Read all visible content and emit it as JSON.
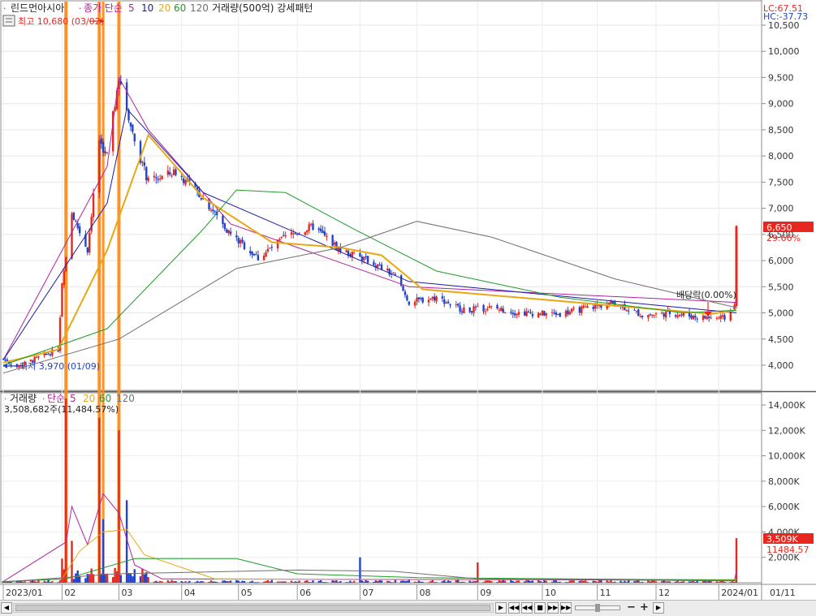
{
  "stock": {
    "name": "린드먼아시아",
    "price_legend": "종가 단순",
    "ma_periods": [
      "5",
      "10",
      "20",
      "60",
      "120"
    ],
    "volume_indicator": "거래량(500억) 강세패턴",
    "high_marker": "최고 10,680 (03/02)",
    "low_marker": "최저 3,970 (01/09)",
    "current_price": "6,650",
    "change_pct": "29.66%",
    "dividend_label": "배당락(0.00%)",
    "lc": "LC:67.51",
    "hc": "HC:-37.73"
  },
  "volume": {
    "legend_title": "거래량",
    "legend_ma": "단순",
    "ma_periods": [
      "5",
      "20",
      "60",
      "120"
    ],
    "last_volume": "3,508,682주(11,484.57%)",
    "current_badge": "3,509K",
    "pct_badge": "11484.57"
  },
  "axes": {
    "price_ticks": [
      "10,500",
      "10,000",
      "9,500",
      "9,000",
      "8,500",
      "8,000",
      "7,500",
      "7,000",
      "6,500",
      "6,000",
      "5,500",
      "5,000",
      "4,500",
      "4,000"
    ],
    "volume_ticks": [
      "14,000K",
      "12,000K",
      "10,000K",
      "8,000K",
      "6,000K",
      "4,000K",
      "2,000K"
    ],
    "months": [
      "2023/01",
      "02",
      "03",
      "04",
      "05",
      "06",
      "07",
      "08",
      "09",
      "10",
      "11",
      "12",
      "2024/01",
      "01/11"
    ]
  },
  "colors": {
    "up": "#e8281f",
    "down": "#2244cc",
    "ma5": "#b0219e",
    "ma10": "#1a1aa8",
    "ma20": "#e8a814",
    "ma60": "#1f9b2a",
    "ma120": "#707070",
    "highlight": "#ff8c1a",
    "badge": "#e8281f"
  },
  "scrollbar": {
    "zoom_minus": "−",
    "zoom_plus": "+"
  },
  "chart_data": {
    "type": "candlestick",
    "title": "린드먼아시아",
    "price_range": [
      3700,
      10800
    ],
    "volume_range": [
      0,
      15000
    ],
    "volume_unit": "K",
    "anchors": [
      {
        "date": "2023/01/02",
        "close": 4120
      },
      {
        "date": "2023/01/09",
        "close": 3970
      },
      {
        "date": "2023/01/30",
        "close": 4300
      },
      {
        "date": "2023/02/01",
        "close": 5600
      },
      {
        "date": "2023/02/06",
        "close": 6900
      },
      {
        "date": "2023/02/14",
        "close": 6200
      },
      {
        "date": "2023/02/20",
        "close": 8300
      },
      {
        "date": "2023/02/24",
        "close": 8000
      },
      {
        "date": "2023/03/02",
        "close": 9500
      },
      {
        "date": "2023/03/10",
        "close": 8300
      },
      {
        "date": "2023/03/17",
        "close": 7500
      },
      {
        "date": "2023/03/31",
        "close": 7700
      },
      {
        "date": "2023/04/14",
        "close": 7200
      },
      {
        "date": "2023/04/28",
        "close": 6500
      },
      {
        "date": "2023/05/12",
        "close": 6050
      },
      {
        "date": "2023/05/26",
        "close": 6450
      },
      {
        "date": "2023/06/09",
        "close": 6650
      },
      {
        "date": "2023/06/23",
        "close": 6200
      },
      {
        "date": "2023/07/07",
        "close": 6000
      },
      {
        "date": "2023/07/21",
        "close": 5700
      },
      {
        "date": "2023/07/28",
        "close": 5200
      },
      {
        "date": "2023/08/11",
        "close": 5300
      },
      {
        "date": "2023/08/25",
        "close": 5050
      },
      {
        "date": "2023/09/08",
        "close": 5100
      },
      {
        "date": "2023/09/22",
        "close": 5000
      },
      {
        "date": "2023/10/13",
        "close": 4980
      },
      {
        "date": "2023/10/27",
        "close": 5100
      },
      {
        "date": "2023/11/10",
        "close": 5200
      },
      {
        "date": "2023/11/24",
        "close": 4950
      },
      {
        "date": "2023/12/08",
        "close": 5000
      },
      {
        "date": "2023/12/22",
        "close": 4920
      },
      {
        "date": "2024/01/05",
        "close": 4900
      },
      {
        "date": "2024/01/10",
        "close": 5130
      },
      {
        "date": "2024/01/11",
        "close": 6650
      }
    ],
    "ma_series": [
      {
        "name": "5",
        "points": [
          [
            "2023/01/02",
            4100
          ],
          [
            "2023/02/24",
            7800
          ],
          [
            "2023/03/02",
            9500
          ],
          [
            "2023/03/17",
            8500
          ],
          [
            "2023/04/28",
            6700
          ],
          [
            "2023/07/28",
            5500
          ],
          [
            "2024/01/11",
            5200
          ]
        ]
      },
      {
        "name": "10",
        "points": [
          [
            "2023/01/02",
            4100
          ],
          [
            "2023/02/24",
            7100
          ],
          [
            "2023/03/06",
            8900
          ],
          [
            "2023/04/14",
            7300
          ],
          [
            "2023/07/28",
            5600
          ],
          [
            "2024/01/11",
            5000
          ]
        ]
      },
      {
        "name": "20",
        "points": [
          [
            "2023/01/02",
            4050
          ],
          [
            "2023/01/30",
            4300
          ],
          [
            "2023/02/24",
            6200
          ],
          [
            "2023/03/17",
            8400
          ],
          [
            "2023/04/14",
            7200
          ],
          [
            "2023/05/19",
            6350
          ],
          [
            "2023/06/23",
            6250
          ],
          [
            "2023/07/14",
            6100
          ],
          [
            "2023/08/04",
            5450
          ],
          [
            "2023/12/29",
            4980
          ],
          [
            "2024/01/11",
            5050
          ]
        ]
      },
      {
        "name": "60",
        "points": [
          [
            "2023/01/02",
            4000
          ],
          [
            "2023/02/24",
            4700
          ],
          [
            "2023/04/14",
            6600
          ],
          [
            "2023/05/01",
            7350
          ],
          [
            "2023/05/26",
            7300
          ],
          [
            "2023/06/30",
            6600
          ],
          [
            "2023/08/11",
            5800
          ],
          [
            "2023/10/13",
            5300
          ],
          [
            "2023/12/15",
            5000
          ],
          [
            "2024/01/11",
            5050
          ]
        ]
      },
      {
        "name": "120",
        "points": [
          [
            "2023/01/02",
            3850
          ],
          [
            "2023/03/02",
            4500
          ],
          [
            "2023/05/01",
            5850
          ],
          [
            "2023/06/23",
            6250
          ],
          [
            "2023/08/01",
            6750
          ],
          [
            "2023/09/08",
            6450
          ],
          [
            "2023/11/10",
            5650
          ],
          [
            "2024/01/11",
            5100
          ]
        ]
      }
    ],
    "volume_spikes": [
      {
        "date": "2023/02/01",
        "value": 1900
      },
      {
        "date": "2023/02/03",
        "value": 14500
      },
      {
        "date": "2023/02/06",
        "value": 3300
      },
      {
        "date": "2023/02/20",
        "value": 13000
      },
      {
        "date": "2023/02/22",
        "value": 5000
      },
      {
        "date": "2023/03/02",
        "value": 12000
      },
      {
        "date": "2023/03/06",
        "value": 6500
      },
      {
        "date": "2023/07/03",
        "value": 2000
      },
      {
        "date": "2023/09/01",
        "value": 1600
      },
      {
        "date": "2024/01/11",
        "value": 3509
      }
    ]
  }
}
